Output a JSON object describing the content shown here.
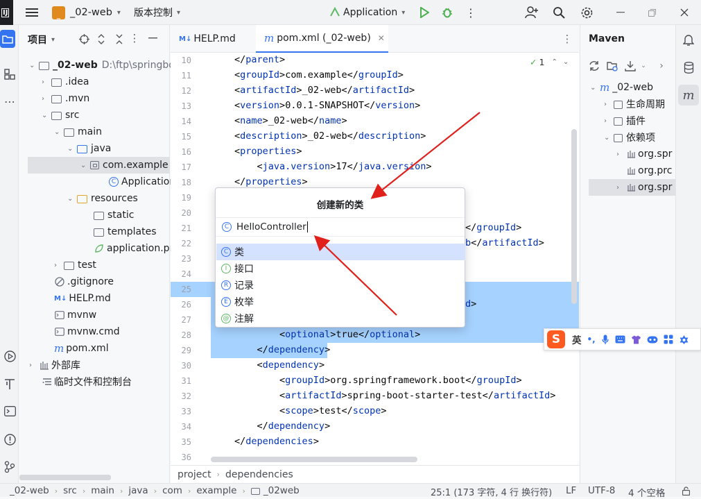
{
  "titlebar": {
    "project_badge": "_",
    "project_name": "_02-web",
    "vcs_menu": "版本控制",
    "run_config": "Application"
  },
  "project_panel": {
    "title": "项目",
    "tree": [
      {
        "label": "_02-web",
        "path": "D:\\ftp\\springbo"
      },
      {
        "label": ".idea"
      },
      {
        "label": ".mvn"
      },
      {
        "label": "src"
      },
      {
        "label": "main"
      },
      {
        "label": "java"
      },
      {
        "label": "com.example"
      },
      {
        "label": "Applicatior"
      },
      {
        "label": "resources"
      },
      {
        "label": "static"
      },
      {
        "label": "templates"
      },
      {
        "label": "application.pr"
      },
      {
        "label": "test"
      },
      {
        "label": ".gitignore"
      },
      {
        "label": "HELP.md"
      },
      {
        "label": "mvnw"
      },
      {
        "label": "mvnw.cmd"
      },
      {
        "label": "pom.xml"
      },
      {
        "label": "外部库"
      },
      {
        "label": "临时文件和控制台"
      }
    ]
  },
  "editor": {
    "tabs": [
      {
        "label": "HELP.md",
        "prefix": "M↓"
      },
      {
        "label": "pom.xml (_02-web)",
        "prefix": "m"
      }
    ],
    "inspection_count": "1",
    "line_numbers": [
      "10",
      "11",
      "12",
      "13",
      "14",
      "15",
      "16",
      "17",
      "18",
      "19",
      "20",
      "21",
      "22",
      "23",
      "24",
      "25",
      "26",
      "27",
      "28",
      "29",
      "30",
      "31",
      "32",
      "33",
      "34",
      "35",
      "36"
    ],
    "lines": [
      {
        "indent": "",
        "open": "</",
        "tag": "parent",
        "close": ">",
        "text": ""
      },
      {
        "indent": "",
        "open": "<",
        "tag": "groupId",
        "mid": "com.example",
        "tag2": "groupId"
      },
      {
        "indent": "",
        "open": "<",
        "tag": "artifactId",
        "mid": "_02-web",
        "tag2": "artifactId"
      },
      {
        "indent": "",
        "open": "<",
        "tag": "version",
        "mid": "0.0.1-SNAPSHOT",
        "tag2": "version"
      },
      {
        "indent": "",
        "open": "<",
        "tag": "name",
        "mid": "_02-web",
        "tag2": "name"
      },
      {
        "indent": "",
        "open": "<",
        "tag": "description",
        "mid": "_02-web",
        "tag2": "description"
      },
      {
        "indent": "",
        "open": "<",
        "tag": "properties",
        "close": ">"
      },
      {
        "indent": "    ",
        "open": "<",
        "tag": "java.version",
        "mid": "17",
        "tag2": "java.version"
      },
      {
        "indent": "",
        "open": "</",
        "tag": "properties",
        "close": ">"
      }
    ],
    "partial_line_21": {
      "tag": "groupId"
    },
    "partial_line_22": {
      "pre": "b",
      "tag": "artifactId"
    },
    "partial_line_26": {
      "tag": "d"
    },
    "lines_lower": [
      {
        "indent": "        ",
        "open": "<",
        "tag": "optional",
        "mid": "true",
        "tag2": "optional"
      },
      {
        "indent": "    ",
        "open": "</",
        "tag": "dependency",
        "close": ">"
      },
      {
        "indent": "    ",
        "open": "<",
        "tag": "dependency",
        "close": ">"
      },
      {
        "indent": "        ",
        "open": "<",
        "tag": "groupId",
        "mid": "org.springframework.boot",
        "tag2": "groupId"
      },
      {
        "indent": "        ",
        "open": "<",
        "tag": "artifactId",
        "mid": "spring-boot-starter-test",
        "tag2": "artifactId"
      },
      {
        "indent": "        ",
        "open": "<",
        "tag": "scope",
        "mid": "test",
        "tag2": "scope"
      },
      {
        "indent": "    ",
        "open": "</",
        "tag": "dependency",
        "close": ">"
      },
      {
        "indent": "",
        "open": "</",
        "tag": "dependencies",
        "close": ">"
      }
    ],
    "breadcrumb": [
      "project",
      "dependencies"
    ]
  },
  "popup": {
    "title": "创建新的类",
    "input_value": "HelloController",
    "kinds": [
      {
        "letter": "C",
        "label": "类"
      },
      {
        "letter": "I",
        "label": "接口"
      },
      {
        "letter": "R",
        "label": "记录"
      },
      {
        "letter": "E",
        "label": "枚举"
      },
      {
        "letter": "@",
        "label": "注解"
      }
    ]
  },
  "maven": {
    "title": "Maven",
    "tree": [
      {
        "label": "_02-web"
      },
      {
        "label": "生命周期"
      },
      {
        "label": "插件"
      },
      {
        "label": "依赖项"
      },
      {
        "label": "org.spr"
      },
      {
        "label": "org.prc"
      },
      {
        "label": "org.spr"
      }
    ]
  },
  "ime": {
    "mode": "英",
    "punct": "•,"
  },
  "statusbar": {
    "path": [
      "_02-web",
      "src",
      "main",
      "java",
      "com",
      "example",
      "_02web"
    ],
    "position": "25:1 (173 字符, 4 行 换行符)",
    "line_sep": "LF",
    "encoding": "UTF-8",
    "indent": "4 个空格"
  },
  "colors": {
    "accent": "#3574f0",
    "selection": "#a6d2ff",
    "tag": "#0033b3",
    "arrow": "#e0201b"
  }
}
